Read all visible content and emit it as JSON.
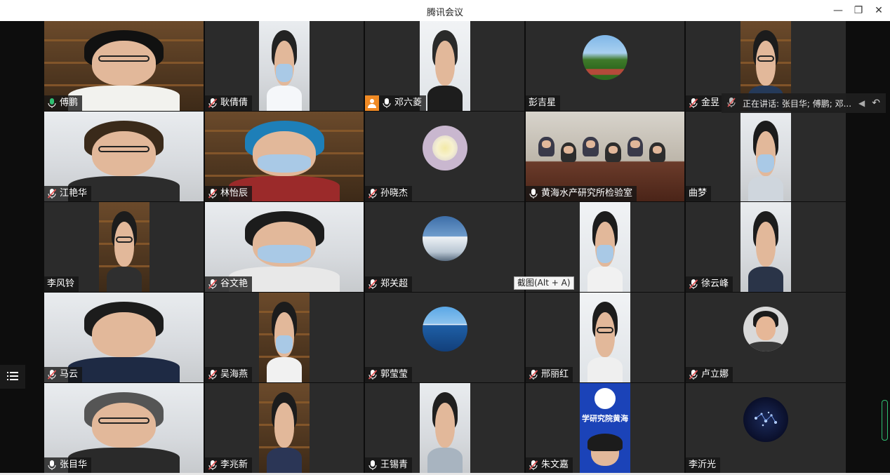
{
  "window": {
    "title": "腾讯会议",
    "minimize": "—",
    "restore": "❐",
    "close": "✕"
  },
  "speaking_text": "正在讲话: 张目华; 傅鹏; 邓...",
  "tooltip": "截图(Alt + A)",
  "participants": [
    {
      "name": "傅鹏",
      "mic": "on",
      "scene": "cam"
    },
    {
      "name": "耿倩倩",
      "mic": "muted",
      "scene": "cam"
    },
    {
      "name": "邓六菱",
      "mic": "unmuted",
      "scene": "cam",
      "host": true
    },
    {
      "name": "彭吉星",
      "mic": "none",
      "scene": "avatar-field"
    },
    {
      "name": "金昱",
      "mic": "muted",
      "scene": "cam"
    },
    {
      "name": "江艳华",
      "mic": "muted",
      "scene": "cam"
    },
    {
      "name": "林怡辰",
      "mic": "muted",
      "scene": "cam"
    },
    {
      "name": "孙晓杰",
      "mic": "muted",
      "scene": "avatar-flower"
    },
    {
      "name": "黄海水产研究所检验室",
      "mic": "unmuted",
      "scene": "cam-room"
    },
    {
      "name": "曲梦",
      "mic": "none",
      "scene": "cam"
    },
    {
      "name": "李风铃",
      "mic": "none",
      "scene": "cam"
    },
    {
      "name": "谷文艳",
      "mic": "muted",
      "scene": "cam"
    },
    {
      "name": "郑关超",
      "mic": "muted",
      "scene": "avatar-mountain"
    },
    {
      "name": "",
      "mic": "none",
      "scene": "cam"
    },
    {
      "name": "徐云峰",
      "mic": "muted",
      "scene": "cam"
    },
    {
      "name": "马云",
      "mic": "muted",
      "scene": "cam"
    },
    {
      "name": "吴海燕",
      "mic": "muted",
      "scene": "cam"
    },
    {
      "name": "郭莹莹",
      "mic": "muted",
      "scene": "avatar-sea"
    },
    {
      "name": "邢丽红",
      "mic": "muted",
      "scene": "cam"
    },
    {
      "name": "卢立娜",
      "mic": "muted",
      "scene": "avatar-person"
    },
    {
      "name": "张目华",
      "mic": "unmuted",
      "scene": "cam",
      "active": true
    },
    {
      "name": "李兆新",
      "mic": "muted",
      "scene": "cam"
    },
    {
      "name": "王锡青",
      "mic": "unmuted",
      "scene": "cam"
    },
    {
      "name": "朱文嘉",
      "mic": "muted",
      "scene": "cam-logo",
      "logo_text": "学研究院黄海"
    },
    {
      "name": "李沂光",
      "mic": "none",
      "scene": "avatar-stars"
    }
  ],
  "colors": {
    "tile_bg": "#2b2b2b",
    "active_border": "#2fbf71",
    "host_badge": "#f08a24",
    "mic_muted": "#e05757"
  }
}
